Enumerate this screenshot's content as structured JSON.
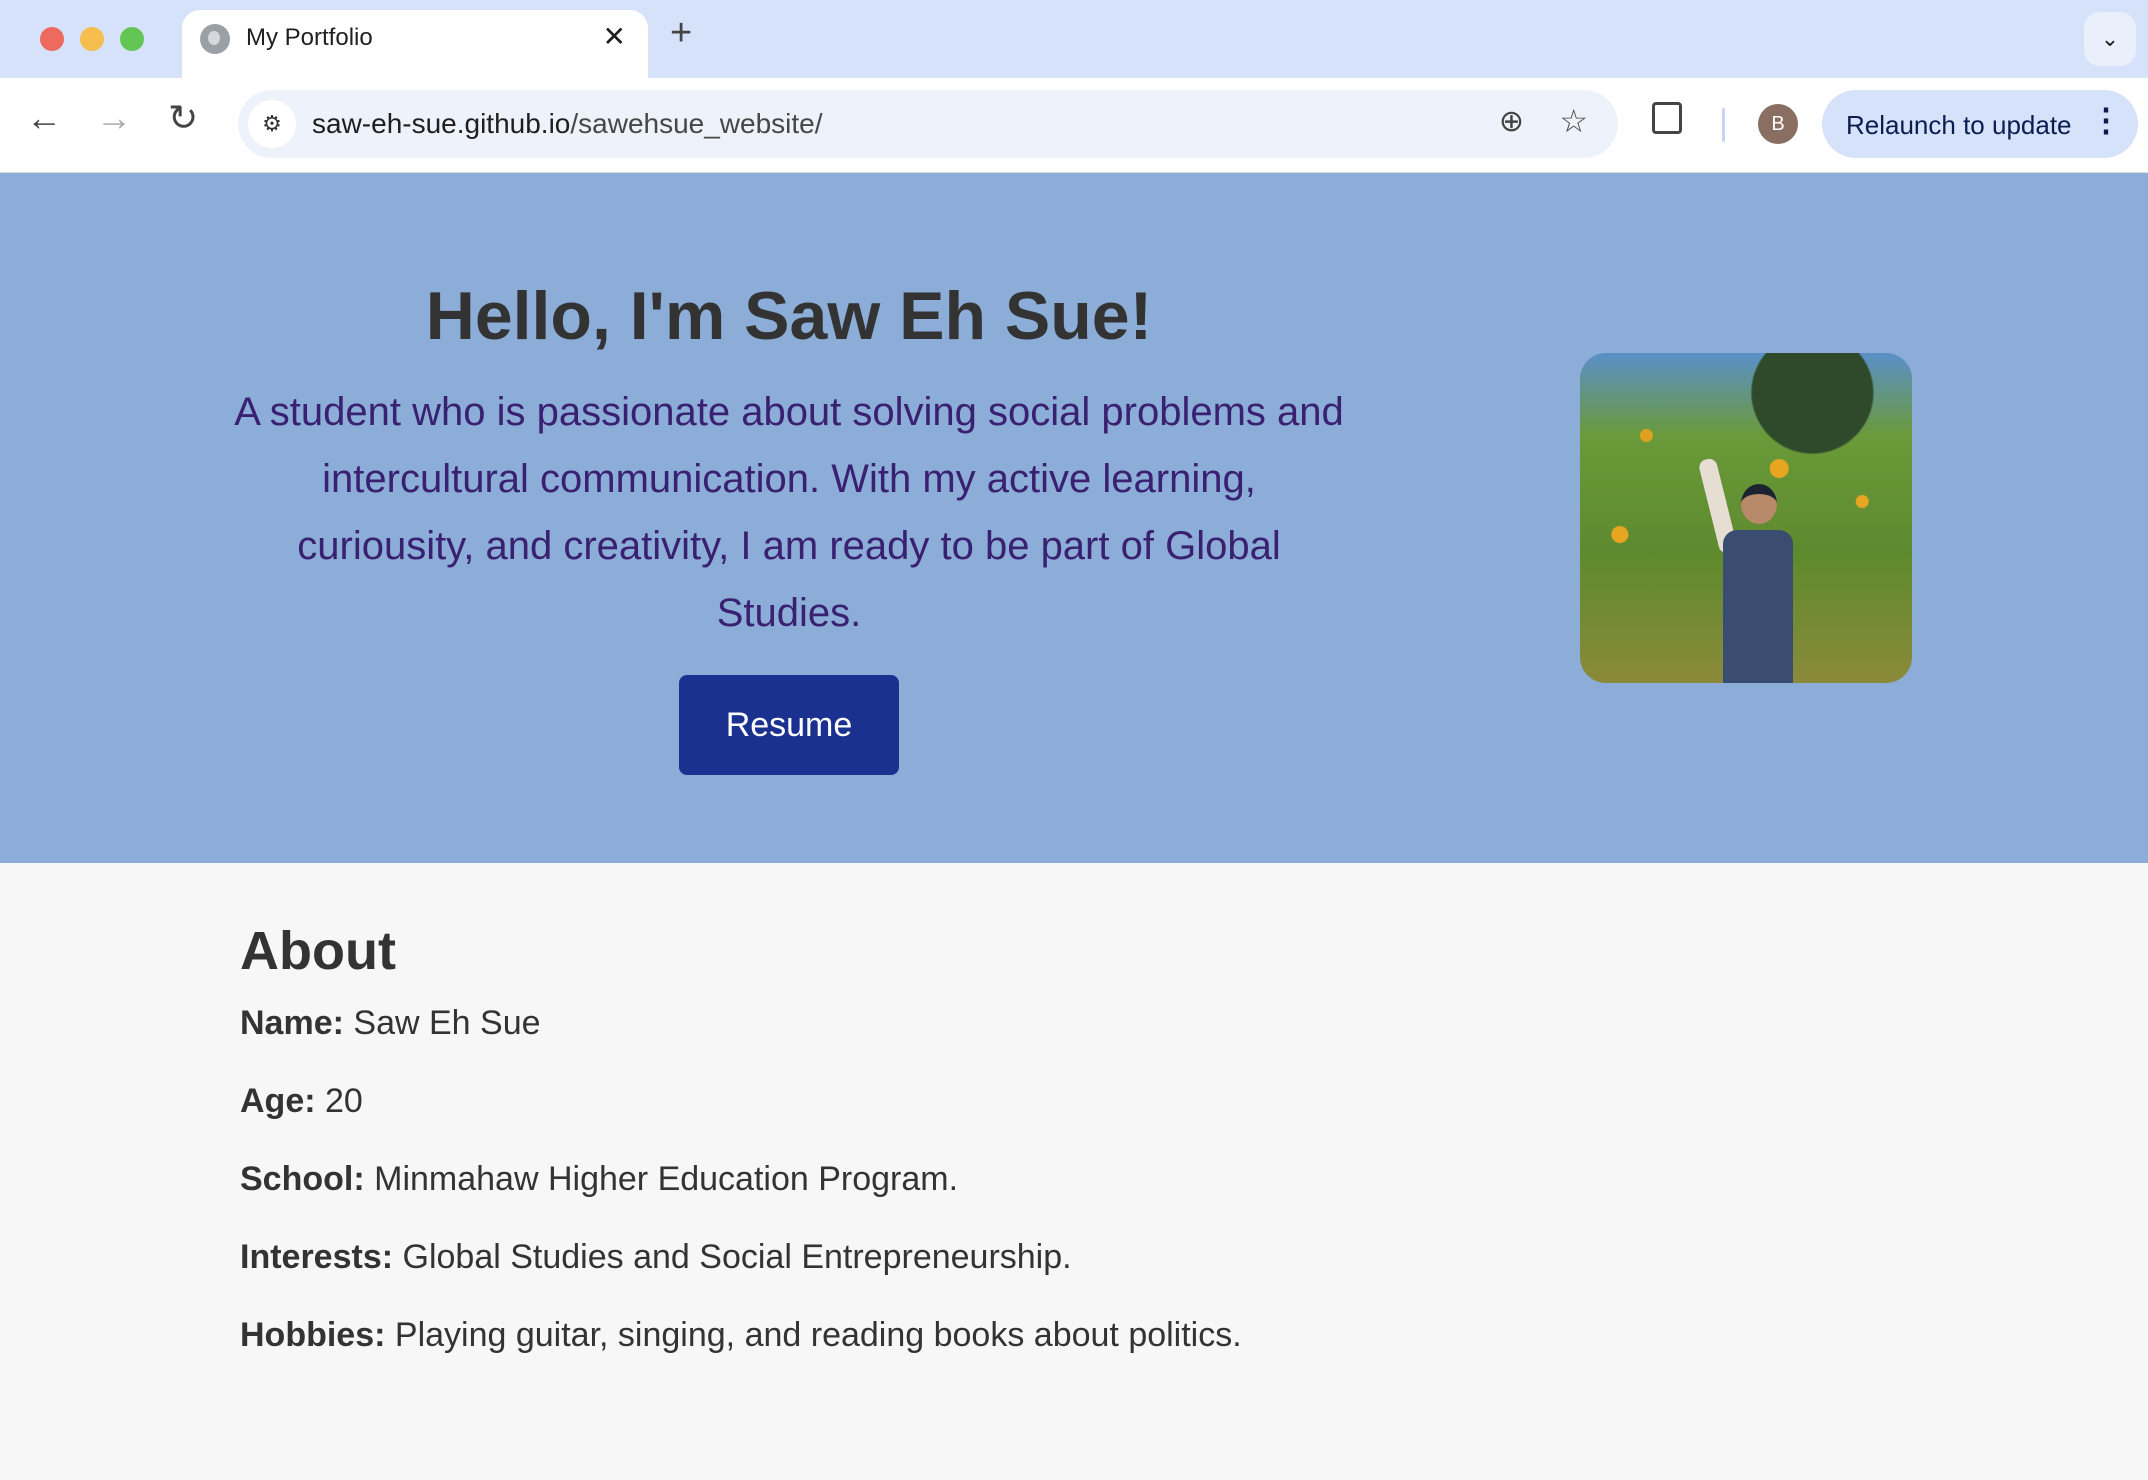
{
  "browser": {
    "tab": {
      "title": "My Portfolio",
      "close_glyph": "✕",
      "icon": "globe-icon"
    },
    "new_tab_glyph": "+",
    "tab_search_glyph": "⌄",
    "nav": {
      "back_glyph": "←",
      "forward_glyph": "→",
      "reload_glyph": "↻"
    },
    "site_info_glyph": "⚙",
    "url": {
      "host": "saw-eh-sue.github.io",
      "path": "/sawehsue_website/"
    },
    "zoom_glyph": "⊕",
    "star_glyph": "☆",
    "avatar_letter": "B",
    "relaunch": {
      "label": "Relaunch to update",
      "menu_glyph": "⋮"
    }
  },
  "hero": {
    "title": "Hello, I'm Saw Eh Sue!",
    "description": "A student who is passionate about solving social problems and intercultural communication. With my active learning, curiousity, and creativity, I am ready to be part of Global Studies.",
    "resume_label": "Resume",
    "photo_alt": "Saw Eh Sue standing under a tree with yellow flowers",
    "colors": {
      "hero_bg": "#8badd8",
      "button_bg": "#1a3190",
      "text_purple": "#3a2070"
    }
  },
  "about": {
    "title": "About",
    "rows": [
      {
        "label": "Name:",
        "value": "Saw Eh Sue"
      },
      {
        "label": "Age:",
        "value": "20"
      },
      {
        "label": "School:",
        "value": "Minmahaw Higher Education Program."
      },
      {
        "label": "Interests:",
        "value": "Global Studies and Social Entrepreneurship."
      },
      {
        "label": "Hobbies:",
        "value": "Playing guitar, singing, and reading books about politics."
      }
    ]
  }
}
